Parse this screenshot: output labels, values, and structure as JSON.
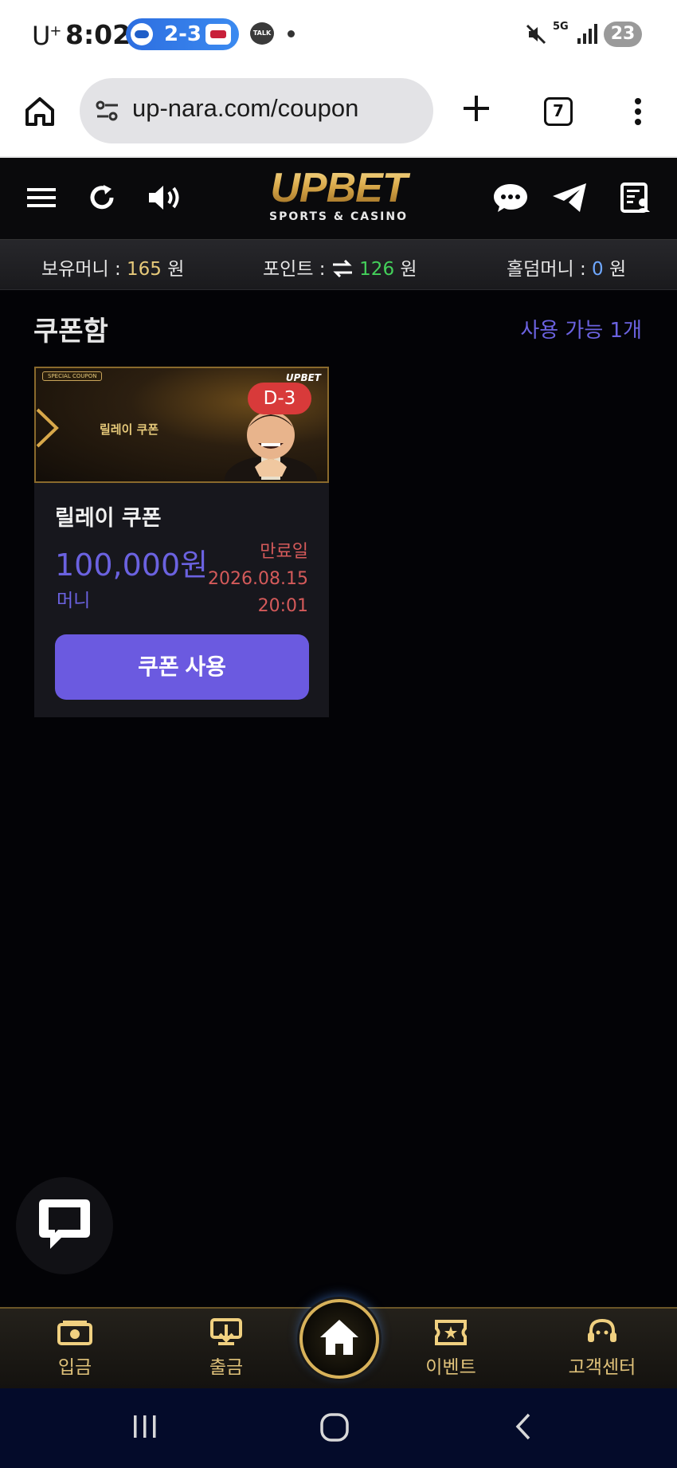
{
  "status_bar": {
    "carrier": "U",
    "carrier_sup": "+",
    "time": "8:02",
    "score": "2-3",
    "talk_label": "TALK",
    "network": "5G",
    "battery": "23"
  },
  "browser": {
    "url": "up-nara.com/coupon",
    "tab_count": "7"
  },
  "header": {
    "logo": "UPBET",
    "logo_sub": "SPORTS & CASINO"
  },
  "balances": {
    "money_label": "보유머니 : ",
    "money_value": "165",
    "money_unit": " 원",
    "point_label": "포인트 : ",
    "point_value": "126",
    "point_unit": " 원",
    "holdem_label": "홀덤머니 : ",
    "holdem_value": "0",
    "holdem_unit": " 원"
  },
  "coupon_section": {
    "title": "쿠폰함",
    "available": "사용 가능 1개"
  },
  "coupon": {
    "banner_tag": "SPECIAL COUPON",
    "banner_title": "릴레이 쿠폰",
    "banner_brand": "UPBET",
    "d_day": "D-3",
    "name": "릴레이 쿠폰",
    "amount": "100,000원",
    "type": "머니",
    "expiry_label": "만료일",
    "expiry_date": "2026.08.15",
    "expiry_time": "20:01",
    "use_button": "쿠폰 사용"
  },
  "bottom_nav": {
    "deposit": "입금",
    "withdraw": "출금",
    "event": "이벤트",
    "support": "고객센터"
  },
  "colors": {
    "accent": "#6b5ae0",
    "gold": "#d8b25a",
    "expiry": "#d45a5a",
    "point_green": "#44d05a"
  }
}
